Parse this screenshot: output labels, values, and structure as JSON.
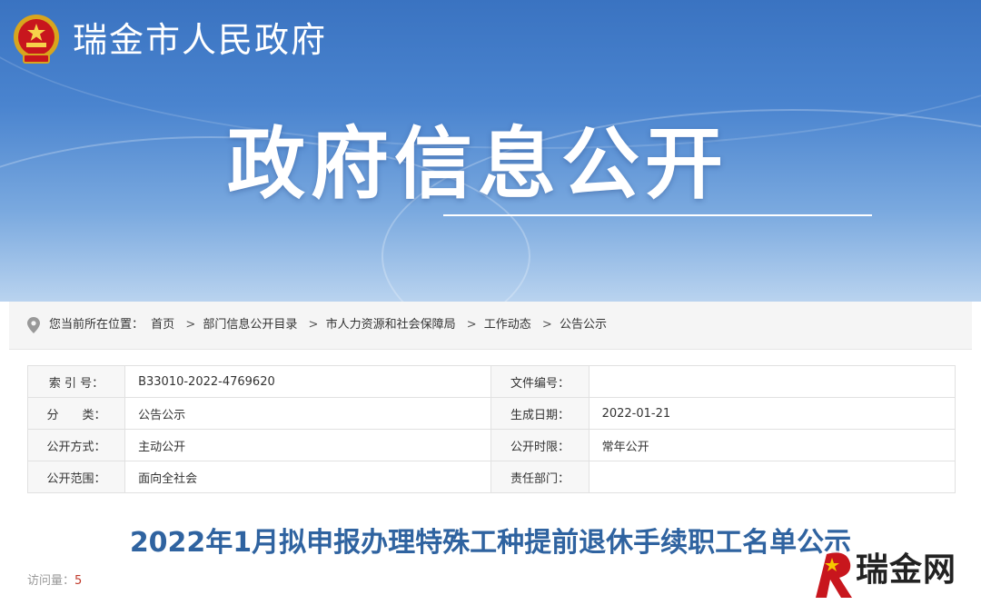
{
  "header": {
    "site_name": "瑞金市人民政府",
    "section_title": "政府信息公开"
  },
  "breadcrumb": {
    "prefix": "您当前所在位置：",
    "items": [
      "首页",
      "部门信息公开目录",
      "市人力资源和社会保障局",
      "工作动态",
      "公告公示"
    ],
    "separator": ">"
  },
  "meta_table": {
    "rows": [
      {
        "k1": "索 引 号：",
        "v1": "B33010-2022-4769620",
        "k2": "文件编号：",
        "v2": ""
      },
      {
        "k1": "分　　类：",
        "v1": "公告公示",
        "k2": "生成日期：",
        "v2": "2022-01-21"
      },
      {
        "k1": "公开方式：",
        "v1": "主动公开",
        "k2": "公开时限：",
        "v2": "常年公开"
      },
      {
        "k1": "公开范围：",
        "v1": "面向全社会",
        "k2": "责任部门：",
        "v2": ""
      }
    ]
  },
  "article": {
    "title": "2022年1月拟申报办理特殊工种提前退休手续职工名单公示",
    "visits_label": "访问量：",
    "visits_count": "5"
  },
  "watermark": {
    "text": "瑞金网"
  },
  "colors": {
    "banner": "#4a84cf",
    "title_blue": "#2f63a0",
    "visits_red": "#c0392b"
  }
}
